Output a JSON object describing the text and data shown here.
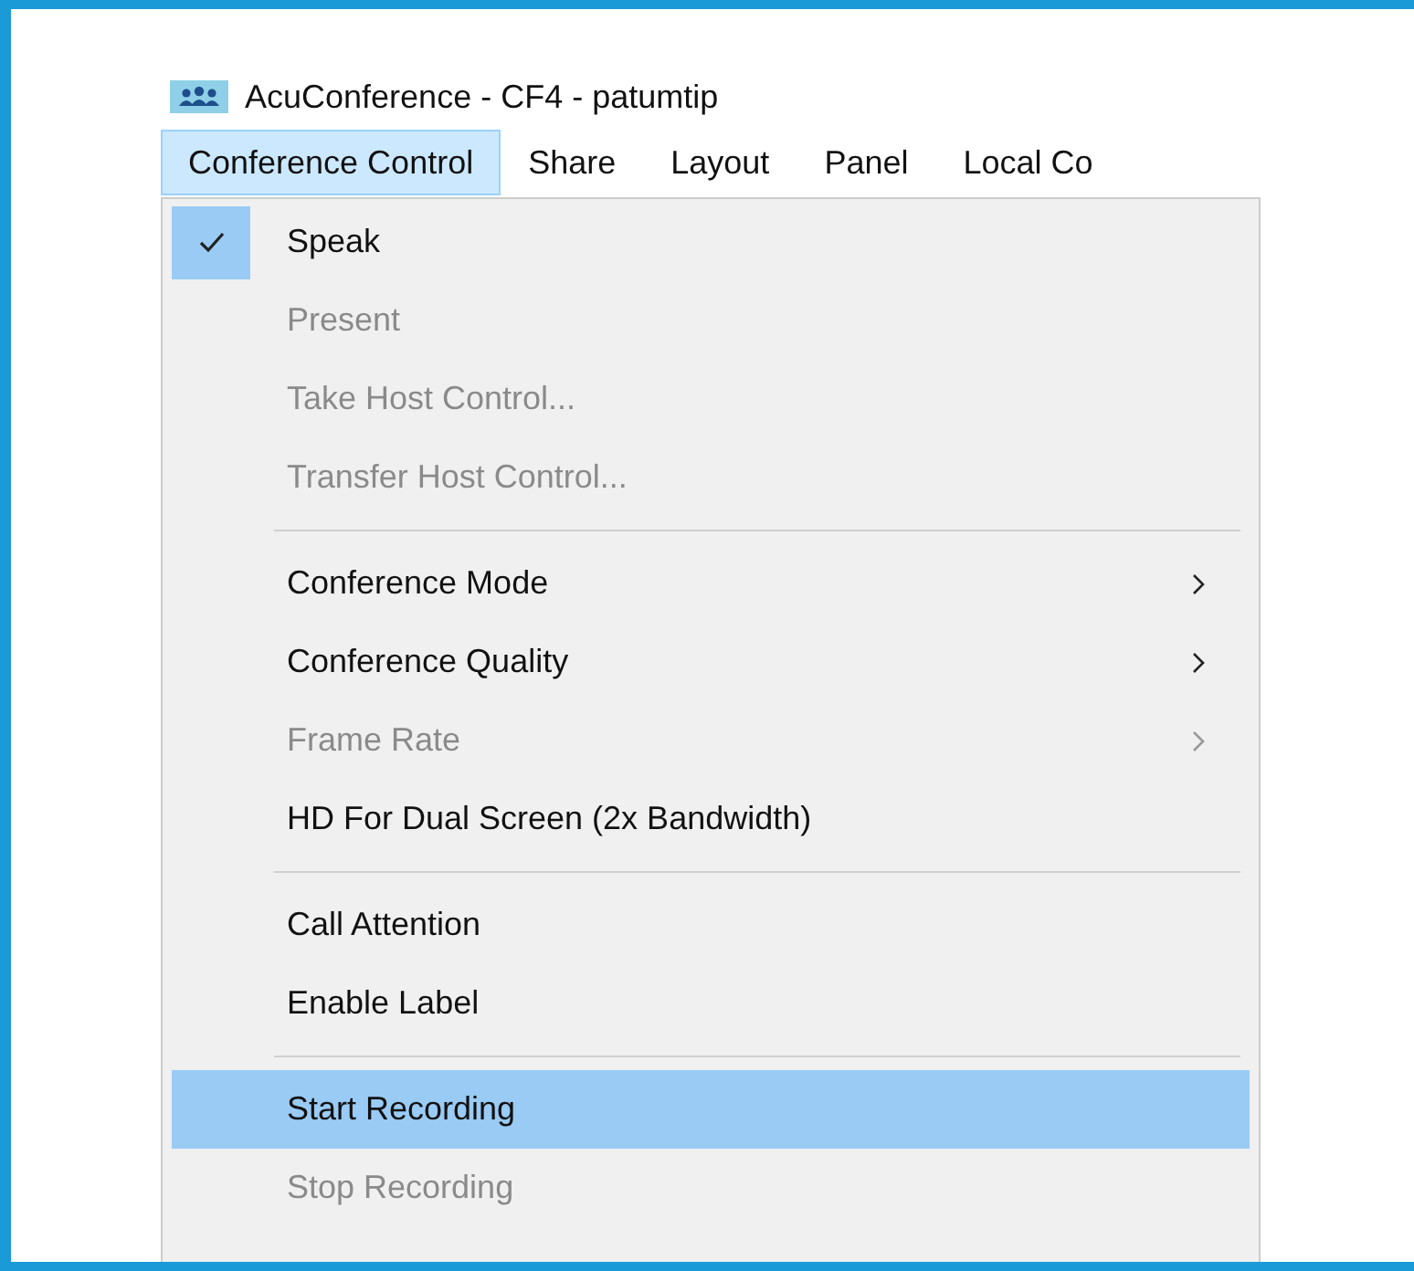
{
  "window": {
    "title": "AcuConference - CF4 - patumtip"
  },
  "menubar": [
    {
      "label": "Conference Control",
      "selected": true
    },
    {
      "label": "Share",
      "selected": false
    },
    {
      "label": "Layout",
      "selected": false
    },
    {
      "label": "Panel",
      "selected": false
    },
    {
      "label": "Local Co",
      "selected": false
    }
  ],
  "menu": [
    {
      "kind": "item",
      "label": "Speak",
      "checked": true,
      "disabled": false,
      "submenu": false,
      "selected": false
    },
    {
      "kind": "item",
      "label": "Present",
      "checked": false,
      "disabled": true,
      "submenu": false,
      "selected": false
    },
    {
      "kind": "item",
      "label": "Take Host Control...",
      "checked": false,
      "disabled": true,
      "submenu": false,
      "selected": false
    },
    {
      "kind": "item",
      "label": "Transfer Host Control...",
      "checked": false,
      "disabled": true,
      "submenu": false,
      "selected": false
    },
    {
      "kind": "separator"
    },
    {
      "kind": "item",
      "label": "Conference Mode",
      "checked": false,
      "disabled": false,
      "submenu": true,
      "selected": false
    },
    {
      "kind": "item",
      "label": "Conference Quality",
      "checked": false,
      "disabled": false,
      "submenu": true,
      "selected": false
    },
    {
      "kind": "item",
      "label": "Frame Rate",
      "checked": false,
      "disabled": true,
      "submenu": true,
      "selected": false
    },
    {
      "kind": "item",
      "label": "HD For Dual Screen (2x Bandwidth)",
      "checked": false,
      "disabled": false,
      "submenu": false,
      "selected": false
    },
    {
      "kind": "separator"
    },
    {
      "kind": "item",
      "label": "Call Attention",
      "checked": false,
      "disabled": false,
      "submenu": false,
      "selected": false
    },
    {
      "kind": "item",
      "label": "Enable Label",
      "checked": false,
      "disabled": false,
      "submenu": false,
      "selected": false
    },
    {
      "kind": "separator"
    },
    {
      "kind": "item",
      "label": "Start Recording",
      "checked": false,
      "disabled": false,
      "submenu": false,
      "selected": true
    },
    {
      "kind": "item",
      "label": "Stop Recording",
      "checked": false,
      "disabled": true,
      "submenu": false,
      "selected": false
    }
  ]
}
